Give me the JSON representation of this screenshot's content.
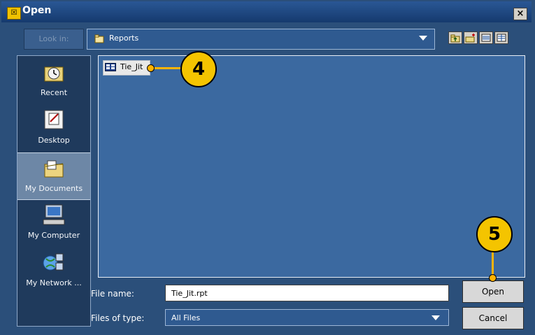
{
  "window": {
    "title": "Open",
    "close_label": "×"
  },
  "toolbar": {
    "look_in_label": "Look in:",
    "current_folder": "Reports"
  },
  "sidebar": {
    "items": [
      {
        "label": "Recent",
        "icon": "clock-folder-icon"
      },
      {
        "label": "Desktop",
        "icon": "desktop-note-icon"
      },
      {
        "label": "My Documents",
        "icon": "documents-folder-icon"
      },
      {
        "label": "My Computer",
        "icon": "computer-icon"
      },
      {
        "label": "My Network ...",
        "icon": "network-icon"
      }
    ],
    "active_index": 2
  },
  "files": [
    {
      "name": "Tie_Jit",
      "icon": "report-file-icon"
    }
  ],
  "form": {
    "file_name_label": "File name:",
    "file_name_value": "Tie_Jit.rpt",
    "file_type_label": "Files of type:",
    "file_type_value": "All Files"
  },
  "buttons": {
    "open": "Open",
    "cancel": "Cancel"
  },
  "callouts": [
    {
      "number": "4"
    },
    {
      "number": "5"
    }
  ],
  "colors": {
    "accent": "#f4c400",
    "pane": "#3b69a0",
    "frame": "#2b4f7a"
  }
}
